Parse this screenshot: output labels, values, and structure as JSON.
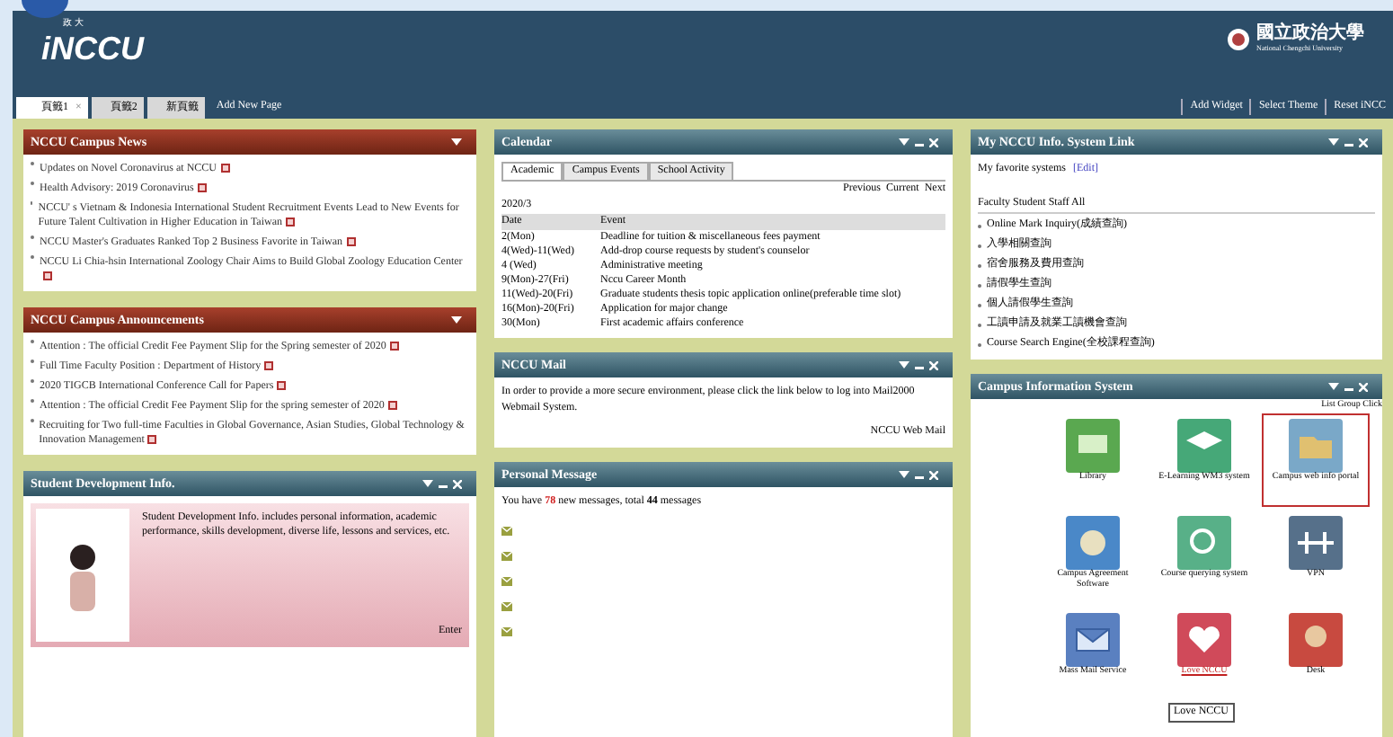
{
  "header": {
    "logo_small": "政 大",
    "logo": "iNCCU",
    "tabs": [
      {
        "label": "頁籤1",
        "close": "×",
        "selected": true
      },
      {
        "label": "頁籤2",
        "selected": false
      },
      {
        "label": "新頁籤",
        "selected": false
      }
    ],
    "add_page": "Add New Page",
    "links": [
      "Add Widget",
      "Select Theme",
      "Reset iNCC"
    ],
    "university": "國立政治大學",
    "university_en": "National Chengchi University"
  },
  "left": [
    {
      "title": "NCCU Campus News",
      "items": [
        "Updates on Novel Coronavirus at NCCU",
        "Health Advisory: 2019 Coronavirus",
        "NCCU' s Vietnam & Indonesia International Student Recruitment Events Lead to New Events for Future Talent Cultivation in Higher Education in Taiwan",
        "NCCU Master's Graduates Ranked Top 2 Business Favorite in Taiwan",
        "NCCU Li Chia-hsin International Zoology Chair Aims to Build Global Zoology Education Center"
      ]
    },
    {
      "title": "NCCU Campus Announcements",
      "items": [
        "Attention : The official Credit Fee Payment Slip for the Spring semester of 2020",
        "Full Time Faculty Position : Department of History",
        "2020 TIGCB International Conference Call for Papers",
        "Attention : The official Credit Fee Payment Slip for the spring semester of 2020",
        "Recruiting for Two full-time Faculties in Global Governance, Asian Studies, Global Technology & Innovation Management"
      ]
    }
  ],
  "student_dev": {
    "title": "Student Development Info.",
    "text": "Student Development Info. includes personal information, academic performance, skills development, diverse life, lessons and services, etc.",
    "link": "Enter"
  },
  "calendar": {
    "title": "Calendar",
    "tabs": [
      {
        "label": "Academic",
        "selected": true
      },
      {
        "label": "Campus Events",
        "selected": false
      },
      {
        "label": "School Activity",
        "selected": false
      }
    ],
    "nav": "Previous  Current  Next",
    "month": "2020/3",
    "columns": [
      "Date",
      "Event"
    ],
    "rows": [
      [
        "2(Mon)",
        "Deadline for tuition & miscellaneous fees payment"
      ],
      [
        "4(Wed)-11(Wed)",
        "Add-drop course requests by student's counselor"
      ],
      [
        "4 (Wed)",
        "Administrative meeting"
      ],
      [
        "9(Mon)-27(Fri)",
        "Nccu Career Month"
      ],
      [
        "11(Wed)-20(Fri)",
        "Graduate students thesis topic application online(preferable time slot)"
      ],
      [
        "16(Mon)-20(Fri)",
        "Application for major change"
      ],
      [
        "30(Mon)",
        "First academic affairs conference"
      ]
    ]
  },
  "mail": {
    "title": "NCCU Mail",
    "text": "In order to provide a more secure environment, please click the link below to log into Mail2000 Webmail System.",
    "link": "NCCU Web Mail"
  },
  "messages": {
    "title": "Personal Message",
    "prefix": "You have",
    "new_count": "78",
    "middle": "new messages, total",
    "total_count": "44",
    "suffix": "messages",
    "items": [
      {
        "kind": "envelope"
      },
      {
        "kind": "envelope"
      },
      {
        "kind": "envelope"
      },
      {
        "kind": "envelope"
      },
      {
        "kind": "envelope"
      }
    ]
  },
  "info_links": {
    "title": "My NCCU Info. System Link",
    "favorite": "My favorite systems",
    "edit": "[Edit]",
    "filters": "Faculty Student Staff All",
    "items": [
      "Online Mark Inquiry(成績查詢)",
      "入學相關查詢",
      "宿舍服務及費用查詢",
      "請假學生查詢",
      "個人請假學生查詢",
      "工讀申請及就業工讀機會查詢",
      "Course Search Engine(全校課程查詢)"
    ]
  },
  "campus_systems": {
    "title": "Campus Information System",
    "view": "List Group Click",
    "systems": [
      {
        "label": "Library",
        "selected": false,
        "link": false
      },
      {
        "label": "E-Learning WM3 system",
        "selected": false,
        "link": false
      },
      {
        "label": "Campus web info portal",
        "selected": true,
        "link": false
      },
      {
        "label": "Campus Agreement Software",
        "selected": false,
        "link": false
      },
      {
        "label": "Course querying system",
        "selected": false,
        "link": false
      },
      {
        "label": "VPN",
        "selected": false,
        "link": false
      },
      {
        "label": "Mass Mail Service",
        "selected": false,
        "link": false
      },
      {
        "label": "Love NCCU",
        "selected": false,
        "link": true
      },
      {
        "label": "Desk",
        "selected": false,
        "link": false
      }
    ],
    "tooltip": "Love NCCU"
  }
}
